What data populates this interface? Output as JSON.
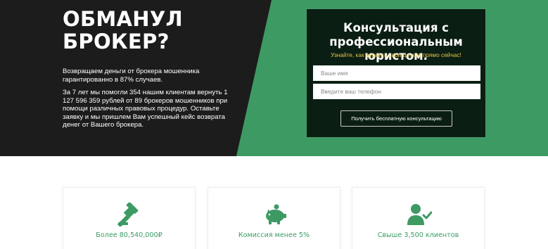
{
  "hero": {
    "title": "ОБМАНУЛ\nБРОКЕР?",
    "lead": "Возвращаем деньги от брокера мошенника гарантированно в 87% случаев.",
    "body": "За 7 лет мы помогли 354 нашим клиентам вернуть 1 127 596 359 рублей от 89 брокеров мошенников при помощи различных правовых процедур. Оставьте заявку и мы пришлем Вам успешный кейс возврата денег от Вашего брокера."
  },
  "form": {
    "title": "Консультация с\nпрофессиональным юристом.",
    "subtitle": "Узнайте, как вернуть свои деньги прямо сейчас!",
    "name_placeholder": "Ваше имя",
    "phone_placeholder": "Введите ваш телефон",
    "submit_label": "Получить бесплатную консультацию"
  },
  "stats": [
    {
      "icon": "gavel-icon",
      "label": "Более 80,540,000₽"
    },
    {
      "icon": "piggy-bank-icon",
      "label": "Комиссия менее 5%"
    },
    {
      "icon": "user-check-icon",
      "label": "Свыше 3,500 клиентов"
    }
  ],
  "colors": {
    "dark": "#1c1c1c",
    "green": "#3d9a63",
    "form_bg": "#0b1e13",
    "accent_yellow": "#e6c34a",
    "stat_green": "#3a9c66"
  }
}
